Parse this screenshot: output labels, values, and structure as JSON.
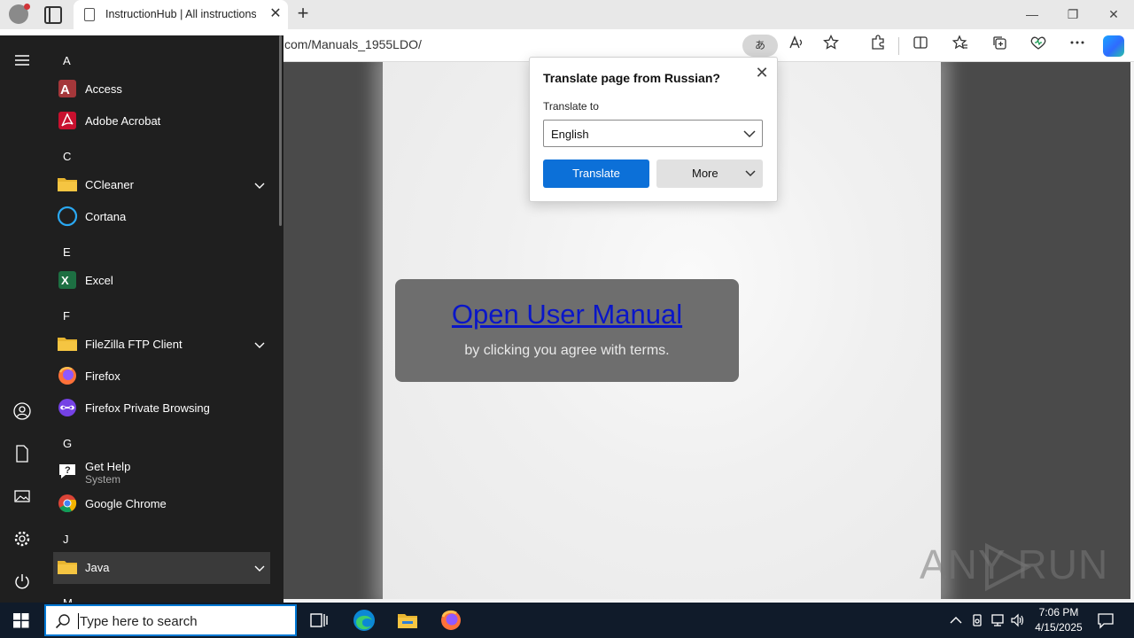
{
  "browser": {
    "tab_title": "InstructionHub | All instructions",
    "tab_close": "✕",
    "new_tab": "+",
    "url_fragment": "com/Manuals_1955LDO/",
    "translate_pill": "あ",
    "window": {
      "minimize": "—",
      "restore": "❐",
      "close": "✕"
    }
  },
  "translate_popup": {
    "heading": "Translate page from Russian?",
    "close": "✕",
    "label": "Translate to",
    "selected_language": "English",
    "translate_button": "Translate",
    "more_button": "More"
  },
  "page": {
    "link_text": "Open User Manual",
    "terms_text": "by clicking you agree with terms.",
    "watermark": "ANY  RUN"
  },
  "start_menu": {
    "groups": [
      {
        "letter": "A",
        "apps": [
          {
            "name": "Access",
            "icon": "access-icon"
          },
          {
            "name": "Adobe Acrobat",
            "icon": "acrobat-icon"
          }
        ]
      },
      {
        "letter": "C",
        "apps": [
          {
            "name": "CCleaner",
            "icon": "folder-icon",
            "expandable": true
          },
          {
            "name": "Cortana",
            "icon": "cortana-icon"
          }
        ]
      },
      {
        "letter": "E",
        "apps": [
          {
            "name": "Excel",
            "icon": "excel-icon"
          }
        ]
      },
      {
        "letter": "F",
        "apps": [
          {
            "name": "FileZilla FTP Client",
            "icon": "folder-icon",
            "expandable": true
          },
          {
            "name": "Firefox",
            "icon": "firefox-icon"
          },
          {
            "name": "Firefox Private Browsing",
            "icon": "firefox-private-icon"
          }
        ]
      },
      {
        "letter": "G",
        "apps": [
          {
            "name": "Get Help",
            "sub": "System",
            "icon": "get-help-icon"
          },
          {
            "name": "Google Chrome",
            "icon": "chrome-icon"
          }
        ]
      },
      {
        "letter": "J",
        "apps": [
          {
            "name": "Java",
            "icon": "folder-icon",
            "expandable": true,
            "selected": true
          }
        ]
      },
      {
        "letter": "M",
        "apps": []
      }
    ]
  },
  "taskbar": {
    "search_placeholder": "Type here to search",
    "time": "7:06 PM",
    "date": "4/15/2025"
  }
}
